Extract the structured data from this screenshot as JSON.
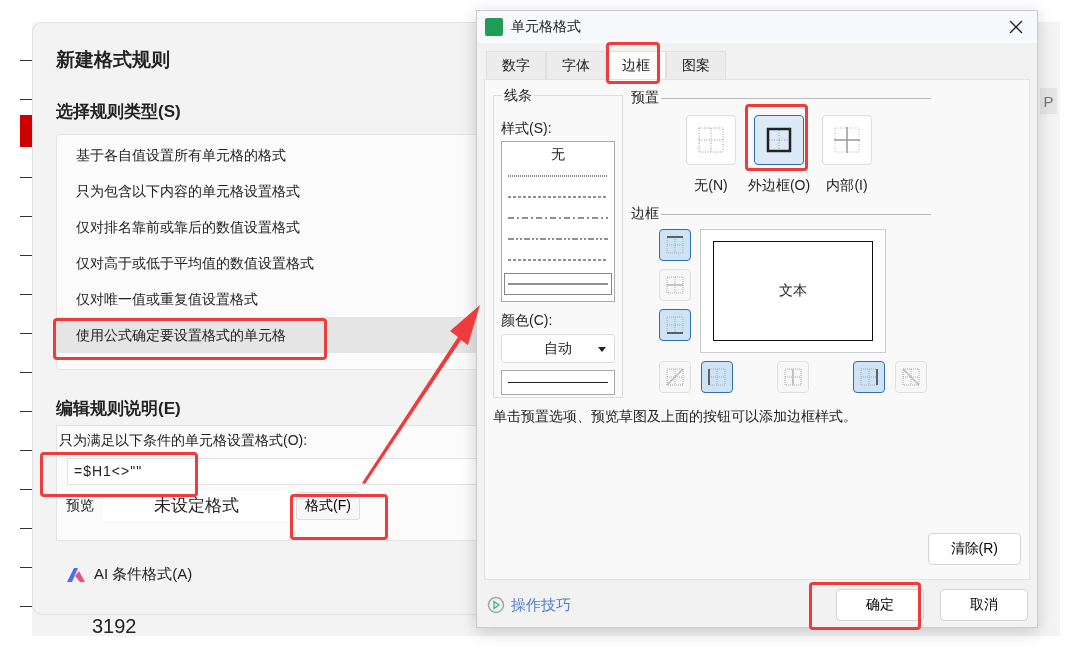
{
  "background_sheet": {
    "cell_value": "3192",
    "side_tab": "P"
  },
  "rule_dialog": {
    "title": "新建格式规则",
    "rule_type_heading": "选择规则类型(S)",
    "rule_types": [
      {
        "label": "基于各自值设置所有单元格的格式",
        "selected": false
      },
      {
        "label": "只为包含以下内容的单元格设置格式",
        "selected": false
      },
      {
        "label": "仅对排名靠前或靠后的数值设置格式",
        "selected": false
      },
      {
        "label": "仅对高于或低于平均值的数值设置格式",
        "selected": false
      },
      {
        "label": "仅对唯一值或重复值设置格式",
        "selected": false
      },
      {
        "label": "使用公式确定要设置格式的单元格",
        "selected": true
      }
    ],
    "description_heading": "编辑规则说明(E)",
    "condition_label": "只为满足以下条件的单元格设置格式(O):",
    "formula": "=$H1<>\"\"",
    "preview_label": "预览",
    "preview_text": "未设定格式",
    "format_button": "格式(F)",
    "ai_button": "AI 条件格式(A)"
  },
  "format_dialog": {
    "title": "单元格格式",
    "tabs": [
      {
        "label": "数字",
        "selected": false
      },
      {
        "label": "字体",
        "selected": false
      },
      {
        "label": "边框",
        "selected": true
      },
      {
        "label": "图案",
        "selected": false
      }
    ],
    "line_group": {
      "title": "线条",
      "style_label": "样式(S):",
      "styles": [
        {
          "kind": "none",
          "label": "无",
          "selected": false
        },
        {
          "kind": "dotted",
          "selected": false
        },
        {
          "kind": "dashed",
          "selected": false
        },
        {
          "kind": "dash-dot",
          "selected": false
        },
        {
          "kind": "dash-dot-dot",
          "selected": false
        },
        {
          "kind": "dashed",
          "selected": false
        },
        {
          "kind": "solid",
          "selected": true
        }
      ],
      "color_label": "颜色(C):",
      "color_value": "自动"
    },
    "preset_heading": "预置",
    "presets": [
      {
        "kind": "none",
        "label": "无(N)",
        "selected": false
      },
      {
        "kind": "outline",
        "label": "外边框(O)",
        "selected": true
      },
      {
        "kind": "inside",
        "label": "内部(I)",
        "selected": false
      }
    ],
    "border_heading": "边框",
    "side_buttons": [
      {
        "kind": "top",
        "on": true
      },
      {
        "kind": "middle-h",
        "on": false
      },
      {
        "kind": "bottom",
        "on": true
      }
    ],
    "bottom_buttons": [
      {
        "kind": "diag-up",
        "on": false
      },
      {
        "kind": "left",
        "on": true
      },
      {
        "kind": "middle-v",
        "on": false
      },
      {
        "kind": "right",
        "on": true
      },
      {
        "kind": "diag-down",
        "on": false
      }
    ],
    "preview_text": "文本",
    "hint": "单击预置选项、预览草图及上面的按钮可以添加边框样式。",
    "clear_button": "清除(R)",
    "tips_link": "操作技巧",
    "ok_button": "确定",
    "cancel_button": "取消"
  }
}
